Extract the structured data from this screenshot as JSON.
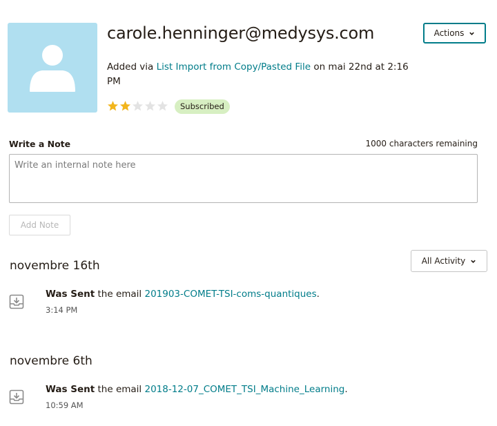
{
  "contact": {
    "email": "carole.henninger@medysys.com",
    "added_prefix": "Added via",
    "added_link": "List Import from Copy/Pasted File",
    "added_suffix": "on mai 22nd at 2:16 PM",
    "rating": 2,
    "rating_max": 5,
    "status": "Subscribed"
  },
  "header": {
    "actions_label": "Actions"
  },
  "note": {
    "label": "Write a Note",
    "chars_remaining": "1000 characters remaining",
    "placeholder": "Write an internal note here",
    "button_label": "Add Note"
  },
  "activity": {
    "filter_label": "All Activity",
    "groups": [
      {
        "date": "novembre 16th",
        "items": [
          {
            "verb": "Was Sent",
            "text": "the email",
            "link": "201903-COMET-TSI-coms-quantiques",
            "end": ".",
            "time": "3:14 PM"
          }
        ]
      },
      {
        "date": "novembre 6th",
        "items": [
          {
            "verb": "Was Sent",
            "text": "the email",
            "link": "2018-12-07_COMET_TSI_Machine_Learning",
            "end": ".",
            "time": "10:59 AM"
          }
        ]
      }
    ]
  },
  "colors": {
    "accent": "#007c89",
    "avatar_bg": "#b0dff0",
    "star_filled": "#f2b51c",
    "star_empty": "#e3e3e3",
    "badge_bg": "#d7efc2"
  },
  "icons": {
    "avatar": "user-silhouette-icon",
    "actions_chevron": "chevron-down-icon",
    "activity_item": "inbox-download-icon"
  }
}
